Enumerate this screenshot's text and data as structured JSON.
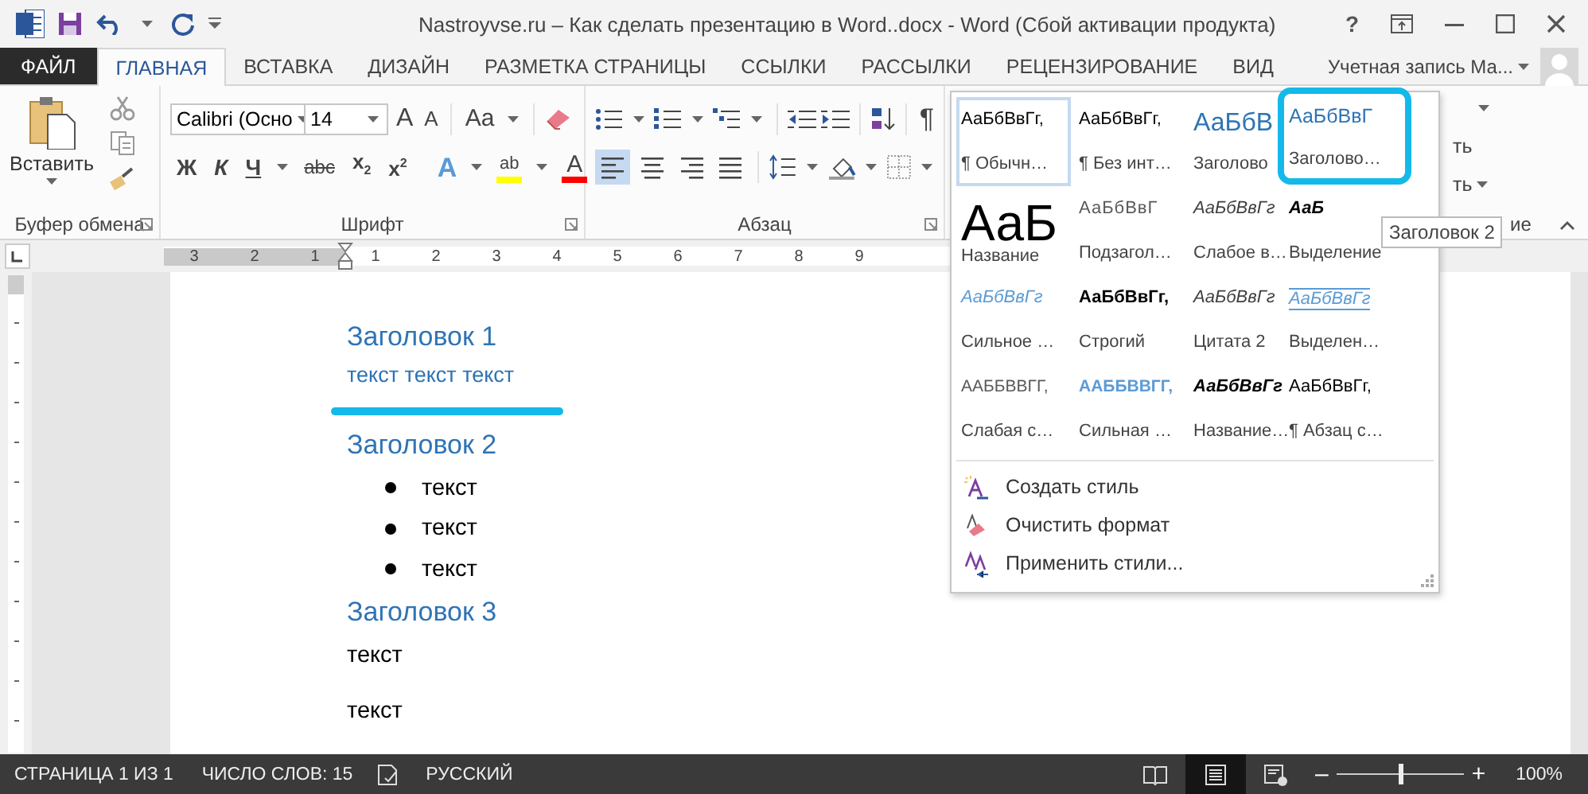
{
  "window": {
    "title": "Nastroyvse.ru – Как сделать презентацию в Word..docx - Word (Сбой активации продукта)",
    "help": "?"
  },
  "tabs": [
    {
      "label": "ФАЙЛ",
      "kind": "file",
      "selected": false
    },
    {
      "label": "ГЛАВНАЯ",
      "kind": "tab",
      "selected": true
    },
    {
      "label": "ВСТАВКА",
      "kind": "tab",
      "selected": false
    },
    {
      "label": "ДИЗАЙН",
      "kind": "tab",
      "selected": false
    },
    {
      "label": "РАЗМЕТКА СТРАНИЦЫ",
      "kind": "tab",
      "selected": false
    },
    {
      "label": "ССЫЛКИ",
      "kind": "tab",
      "selected": false
    },
    {
      "label": "РАССЫЛКИ",
      "kind": "tab",
      "selected": false
    },
    {
      "label": "РЕЦЕНЗИРОВАНИЕ",
      "kind": "tab",
      "selected": false
    },
    {
      "label": "ВИД",
      "kind": "tab",
      "selected": false
    }
  ],
  "account": {
    "label": "Учетная запись Ма..."
  },
  "ribbon": {
    "clipboard": {
      "paste_label": "Вставить",
      "group_label": "Буфер обмена"
    },
    "font": {
      "name": "Calibri (Осно",
      "size": "14",
      "case_label": "Aa",
      "group_label": "Шрифт",
      "size_buttons": [
        {
          "kind": "grow",
          "label": "A"
        },
        {
          "kind": "shrink",
          "label": "A"
        }
      ],
      "format_buttons": [
        {
          "kind": "bold",
          "label": "Ж"
        },
        {
          "kind": "italic",
          "label": "К"
        },
        {
          "kind": "underline",
          "label": "Ч"
        },
        {
          "kind": "strike",
          "label": "abc"
        },
        {
          "kind": "sub",
          "label": "x$_{2}$"
        },
        {
          "kind": "sup",
          "label": "x$^{2}$"
        }
      ],
      "color_buttons": [
        {
          "kind": "effects",
          "label": "A"
        },
        {
          "kind": "highlight",
          "label": "ab",
          "color": "#ffff00"
        },
        {
          "kind": "color",
          "label": "A",
          "color": "#ff0000"
        }
      ]
    },
    "paragraph": {
      "group_label": "Абзац",
      "pilcrow": "¶",
      "alignments": [
        {
          "kind": "left",
          "selected": true
        },
        {
          "kind": "center",
          "selected": false
        },
        {
          "kind": "right",
          "selected": false
        },
        {
          "kind": "justify",
          "selected": false
        }
      ]
    },
    "editing": {
      "texts": [
        "ть",
        "ть"
      ],
      "group_label": "ие"
    }
  },
  "styles_gallery": {
    "items": [
      {
        "kind": "normal",
        "sample": "АаБбВвГг,",
        "name": "¶ Обычн…",
        "selected": true
      },
      {
        "kind": "normal",
        "sample": "АаБбВвГг,",
        "name": "¶ Без инт…",
        "selected": false
      },
      {
        "kind": "h1",
        "sample": "АаБбВ",
        "name": "Заголово",
        "selected": false
      },
      {
        "kind": "h2",
        "sample": "АаБбВвГ",
        "name": "Заголово…",
        "selected": false,
        "highlighted": true
      },
      {
        "kind": "title",
        "sample": "АаБ",
        "name": "Название",
        "selected": false
      },
      {
        "kind": "subtitle",
        "sample": "АаБбВвГ",
        "name": "Подзагол…",
        "selected": false
      },
      {
        "kind": "subtle",
        "sample": "АаБбВвГг",
        "name": "Слабое в…",
        "selected": false
      },
      {
        "kind": "emphasis",
        "sample": "АаБ",
        "name": "Выделение",
        "selected": false
      },
      {
        "kind": "intense",
        "sample": "АаБбВвГг",
        "name": "Сильное …",
        "selected": false
      },
      {
        "kind": "strong",
        "sample": "АаБбВвГг,",
        "name": "Строгий",
        "selected": false
      },
      {
        "kind": "subtle",
        "sample": "АаБбВвГг",
        "name": "Цитата 2",
        "selected": false
      },
      {
        "kind": "intense_quote",
        "sample": "АаБбВвГг",
        "name": "Выделен…",
        "selected": false
      },
      {
        "kind": "subtle_ref",
        "sample": "ААББВВГГ,",
        "name": "Слабая с…",
        "selected": false
      },
      {
        "kind": "intense_ref",
        "sample": "ААББВВГГ,",
        "name": "Сильная …",
        "selected": false
      },
      {
        "kind": "emphasis",
        "sample": "АаБбВвГг",
        "name": "Название…",
        "selected": false
      },
      {
        "kind": "normal",
        "sample": "АаБбВвГг,",
        "name": "¶ Абзац с…",
        "selected": false
      }
    ],
    "commands": [
      {
        "kind": "create",
        "label": "Создать стиль"
      },
      {
        "kind": "clear",
        "label": "Очистить формат"
      },
      {
        "kind": "apply",
        "label": "Применить стили..."
      }
    ]
  },
  "tooltip": "Заголовок 2",
  "ruler": {
    "labels": [
      "3",
      "2",
      "1",
      "1",
      "2",
      "3",
      "4",
      "5",
      "6",
      "7",
      "8",
      "9"
    ]
  },
  "document": {
    "blocks": [
      {
        "kind": "heading",
        "text": "Заголовок 1",
        "highlighted": false
      },
      {
        "kind": "accent",
        "text": "текст текст текст",
        "highlighted": true
      },
      {
        "kind": "heading",
        "text": "Заголовок 2",
        "highlighted": false
      },
      {
        "kind": "bullet",
        "text": "текст",
        "highlighted": false
      },
      {
        "kind": "bullet",
        "text": "текст",
        "highlighted": false
      },
      {
        "kind": "bullet",
        "text": "текст",
        "highlighted": false
      },
      {
        "kind": "heading",
        "text": "Заголовок 3",
        "highlighted": false
      },
      {
        "kind": "body",
        "text": "текст",
        "highlighted": false
      },
      {
        "kind": "body",
        "text": "текст",
        "highlighted": false
      }
    ]
  },
  "status_bar": {
    "page": "СТРАНИЦА 1 ИЗ 1",
    "words": "ЧИСЛО СЛОВ: 15",
    "language": "РУССКИЙ",
    "views": [
      {
        "kind": "read",
        "selected": false
      },
      {
        "kind": "print",
        "selected": true
      },
      {
        "kind": "web",
        "selected": false
      }
    ],
    "zoom": {
      "minus": "–",
      "plus": "+",
      "level": 0.5,
      "reading": "100%"
    }
  }
}
